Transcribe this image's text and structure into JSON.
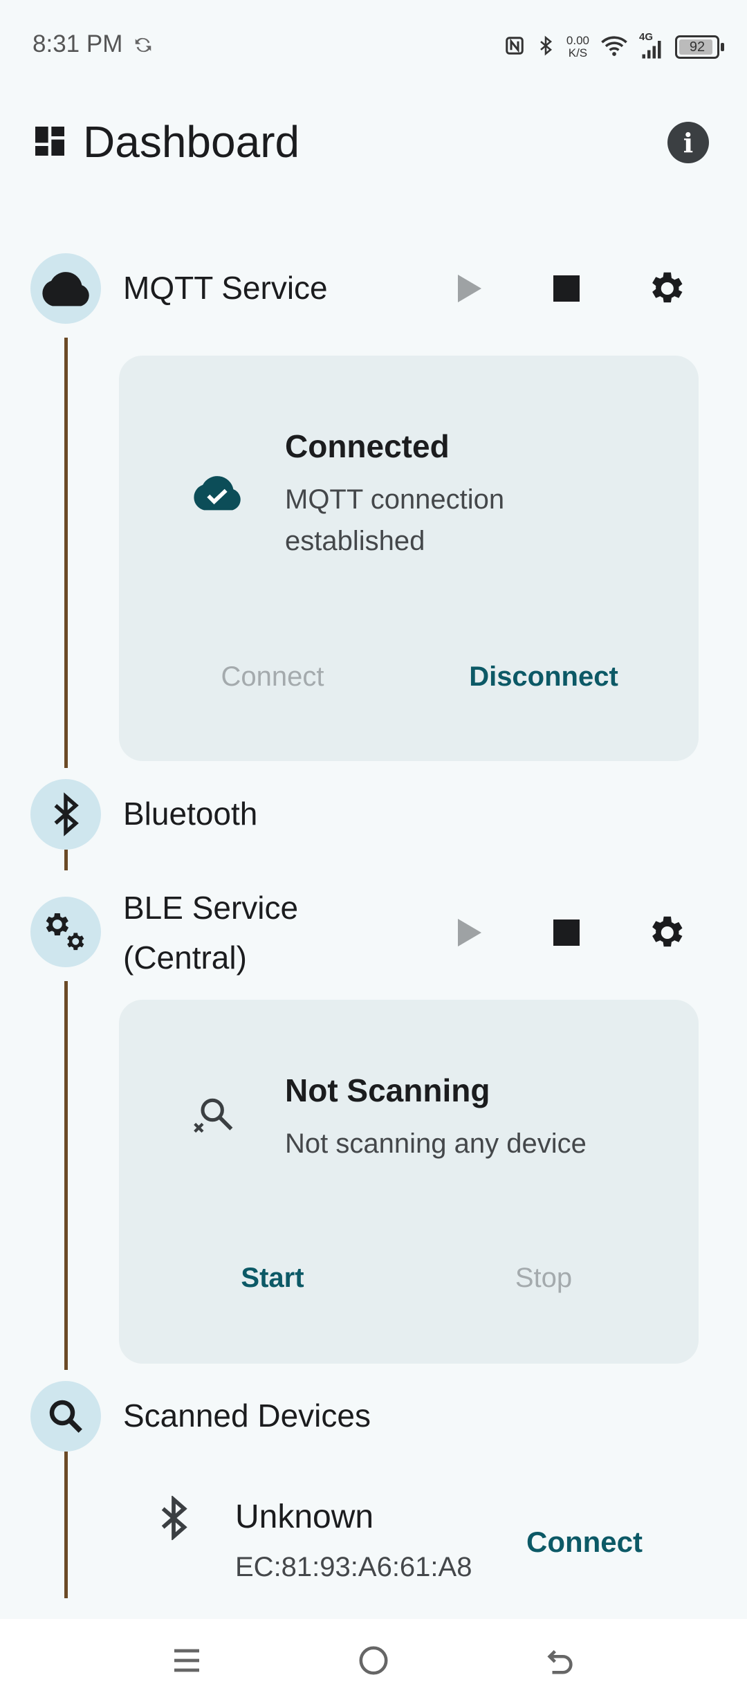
{
  "status_bar": {
    "time": "8:31 PM",
    "net_speed_value": "0.00",
    "net_speed_unit": "K/S",
    "network_type": "4G",
    "battery": "92",
    "battery_level": 0.92
  },
  "header": {
    "title": "Dashboard"
  },
  "mqtt": {
    "title": "MQTT Service",
    "status_title": "Connected",
    "status_sub": "MQTT connection established",
    "connect_label": "Connect",
    "disconnect_label": "Disconnect"
  },
  "bluetooth": {
    "title": "Bluetooth"
  },
  "ble": {
    "title_line1": "BLE Service",
    "title_line2": "(Central)",
    "status_title": "Not Scanning",
    "status_sub": "Not scanning any device",
    "start_label": "Start",
    "stop_label": "Stop"
  },
  "scanned": {
    "title": "Scanned Devices",
    "devices": [
      {
        "name": "Unknown",
        "address": "EC:81:93:A6:61:A8",
        "action": "Connect"
      }
    ]
  },
  "colors": {
    "accent": "#0c5966",
    "timeline": "#6b4a26",
    "icon_circle": "#cfe6ee",
    "card": "#e6eef0"
  }
}
